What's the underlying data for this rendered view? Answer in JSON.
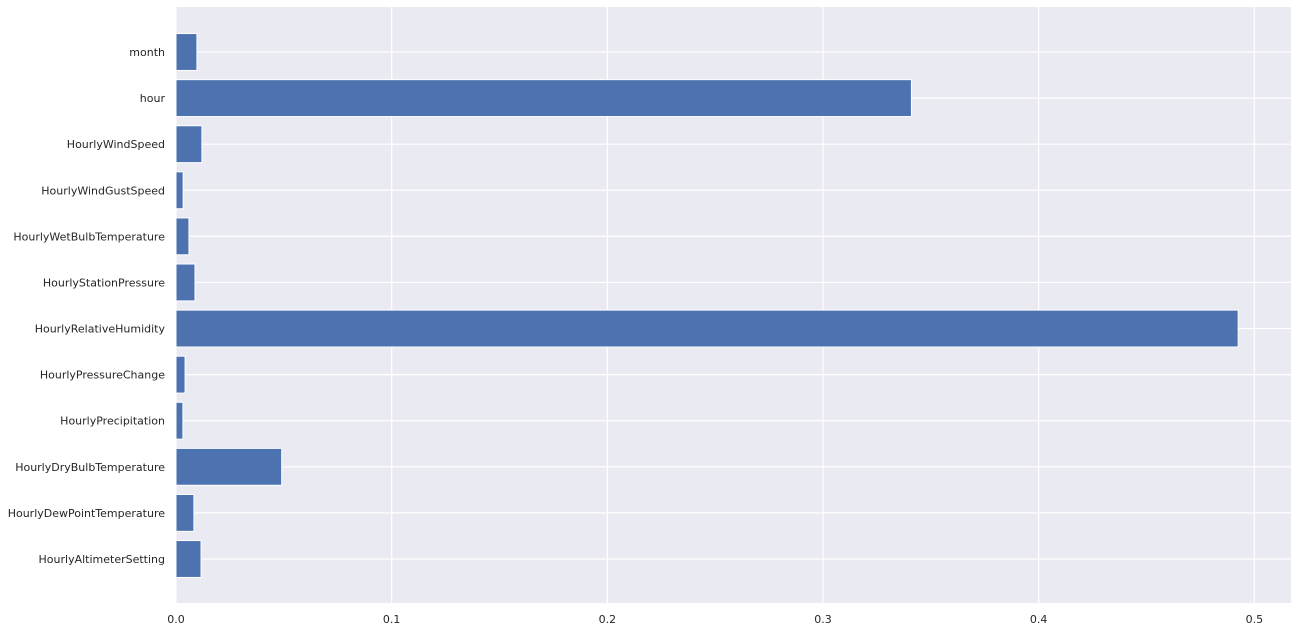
{
  "chart_data": {
    "type": "bar",
    "orientation": "horizontal",
    "title": "",
    "xlabel": "",
    "ylabel": "",
    "categories": [
      "HourlyAltimeterSetting",
      "HourlyDewPointTemperature",
      "HourlyDryBulbTemperature",
      "HourlyPrecipitation",
      "HourlyPressureChange",
      "HourlyRelativeHumidity",
      "HourlyStationPressure",
      "HourlyWetBulbTemperature",
      "HourlyWindGustSpeed",
      "HourlyWindSpeed",
      "hour",
      "month"
    ],
    "values": [
      0.0116,
      0.0083,
      0.049,
      0.0032,
      0.0042,
      0.4925,
      0.0088,
      0.006,
      0.0033,
      0.012,
      0.341,
      0.0097
    ],
    "xlim": [
      0,
      0.517
    ],
    "xticks": [
      0.0,
      0.1,
      0.2,
      0.3,
      0.4,
      0.5
    ],
    "xtick_labels": [
      "0.0",
      "0.1",
      "0.2",
      "0.3",
      "0.4",
      "0.5"
    ],
    "grid": true,
    "legend": "none",
    "colors": {
      "bar": "#4c72b0",
      "background": "#eaeaf2",
      "grid": "#ffffff"
    }
  }
}
